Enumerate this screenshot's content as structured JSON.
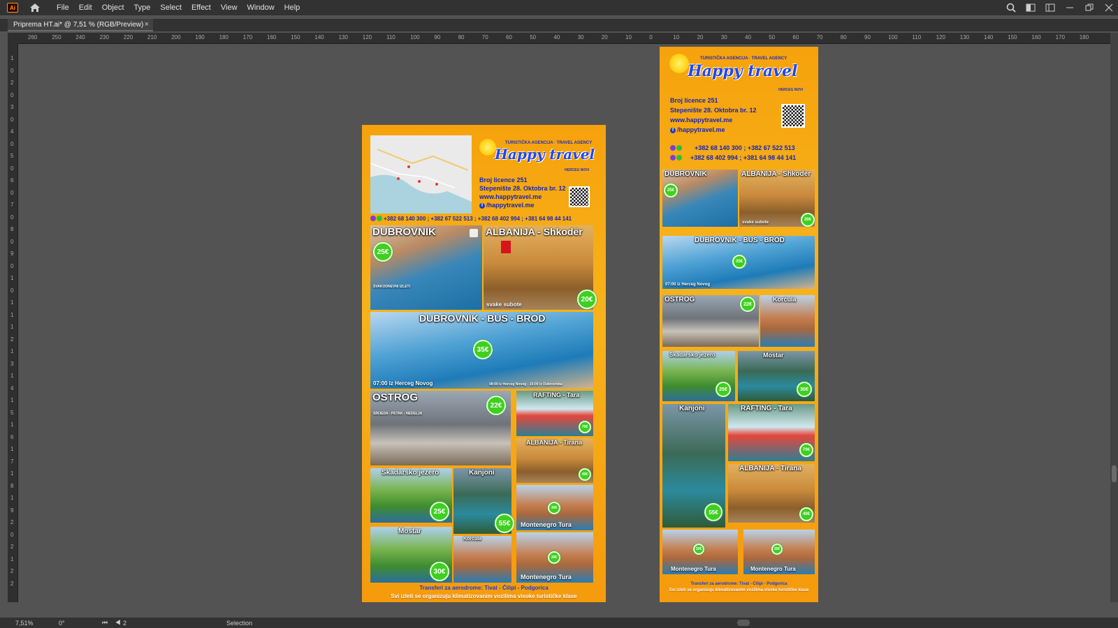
{
  "app": {
    "logo": "Ai",
    "menu": [
      "File",
      "Edit",
      "Object",
      "Type",
      "Select",
      "Effect",
      "View",
      "Window",
      "Help"
    ]
  },
  "document_tab": {
    "title": "Priprema HT.ai* @ 7,51 % (RGB/Preview)",
    "close": "×"
  },
  "ruler": {
    "h_ticks": [
      "260",
      "250",
      "240",
      "230",
      "220",
      "210",
      "200",
      "190",
      "180",
      "170",
      "160",
      "150",
      "140",
      "130",
      "120",
      "110",
      "100",
      "90",
      "80",
      "70",
      "60",
      "50",
      "40",
      "30",
      "20",
      "10",
      "0",
      "10",
      "20",
      "30",
      "40",
      "50",
      "60",
      "70",
      "80",
      "90",
      "100",
      "110",
      "120",
      "130",
      "140",
      "150",
      "160",
      "170",
      "180"
    ],
    "v_ticks": [
      "1",
      "0",
      "2",
      "0",
      "3",
      "0",
      "4",
      "0",
      "5",
      "0",
      "6",
      "0",
      "7",
      "0",
      "8",
      "0",
      "9",
      "0",
      "1",
      "0",
      "1",
      "1",
      "1",
      "2",
      "1",
      "3",
      "1",
      "4",
      "1",
      "5",
      "1",
      "6",
      "1",
      "7",
      "1",
      "8",
      "1",
      "9",
      "2",
      "0",
      "2",
      "1",
      "2",
      "2"
    ]
  },
  "status": {
    "zoom": "7,51%",
    "rotation": "0°",
    "page": "2",
    "tool": "Selection",
    "nav": "⏮ ◀"
  },
  "brand": {
    "agency": "TURISTIČKA AGENCIJA · TRAVEL AGENCY",
    "title": "Happy travel",
    "city": "HERCEG NOVI",
    "licence": "Broj licence 251",
    "address": "Stepenište 28. Oktobra br. 12",
    "web": "www.happytravel.me",
    "facebook": "/happytravel.me",
    "phones_one_line": "+382 68 140 300 ; +382 67 522 513 ; +382 68 402 994 ; +381 64 98 44 141",
    "phones_line1": "+382 68 140 300 ; +382 67 522 513",
    "phones_line2": "+382 68 402 994 ; +381 64 98 44 141"
  },
  "poster_a": {
    "dubrovnik": {
      "label": "DUBROVNIK",
      "price": "25€",
      "note": "SVAKODNEVNI IZLETI"
    },
    "shkoder": {
      "label": "ALBANIJA - Shkodër",
      "price": "20€",
      "sub": "svake subote"
    },
    "busbrod": {
      "label": "DUBROVNIK - BUS - BROD",
      "price": "35€",
      "sub": "07:00 iz Herceg Novog",
      "sub2": "08:00 iz Herceg Novog - 16:00 iz Dubrovnika"
    },
    "ostrog": {
      "label": "OSTROG",
      "price": "22€",
      "note": "SRIJEDA - PETAK - NEDELJA"
    },
    "rafting": {
      "label": "RAFTING - Tara",
      "price": "70€"
    },
    "tirana": {
      "label": "ALBANIJA - Tirana",
      "price": "40€"
    },
    "skadar": {
      "label": "Skadarsko jezero",
      "price": "25€"
    },
    "kanjoni": {
      "label": "Kanjoni",
      "price": "55€"
    },
    "montenegro1": {
      "label": "Montenegro Tura",
      "price": "30€"
    },
    "mostar": {
      "label": "Mostar",
      "price": "30€"
    },
    "korcula": {
      "label": "Korčula"
    },
    "montenegro2": {
      "label": "Montenegro Tura",
      "price": "35€"
    },
    "footer1": "Transferi za aerodrome: Tivat - Ćilipi - Podgorica",
    "footer2": "Svi izleti se organizuju klimatizovanim vozilima visoke turističke klase"
  },
  "poster_b": {
    "dubrovnik": {
      "label": "DUBROVNIK",
      "price": "25€"
    },
    "shkoder": {
      "label": "ALBANIJA - Shkoder",
      "price": "20€",
      "sub": "svake subote"
    },
    "busbrod": {
      "label": "DUBROVNIK - BUS - BROD",
      "price": "35€",
      "sub": "07:00 iz Herceg Novog"
    },
    "ostrog": {
      "label": "OSTROG",
      "price": "22€"
    },
    "korcula": {
      "label": "Korčula"
    },
    "skadar": {
      "label": "Skadarsko jezero",
      "price": "25€"
    },
    "mostar": {
      "label": "Mostar",
      "price": "30€"
    },
    "kanjoni": {
      "label": "Kanjoni",
      "price": "55€"
    },
    "rafting": {
      "label": "RAFTING - Tara",
      "price": "70€"
    },
    "tirana": {
      "label": "ALBANIJA - Tirana",
      "price": "40€"
    },
    "montenegro1": {
      "label": "Montenegro Tura",
      "price": "30€"
    },
    "montenegro2": {
      "label": "Montenegro Tura",
      "price": "35€"
    },
    "footer1": "Transferi za aerodrome: Tivat - Ćilipi - Podgorica",
    "footer2": "Svi izleti se organizuju klimatizovanim vozilima visoke turističke klase"
  },
  "colors": {
    "accent_orange": "#f6a20c",
    "price_green": "#3fcf22",
    "brand_blue": "#1626b6"
  }
}
